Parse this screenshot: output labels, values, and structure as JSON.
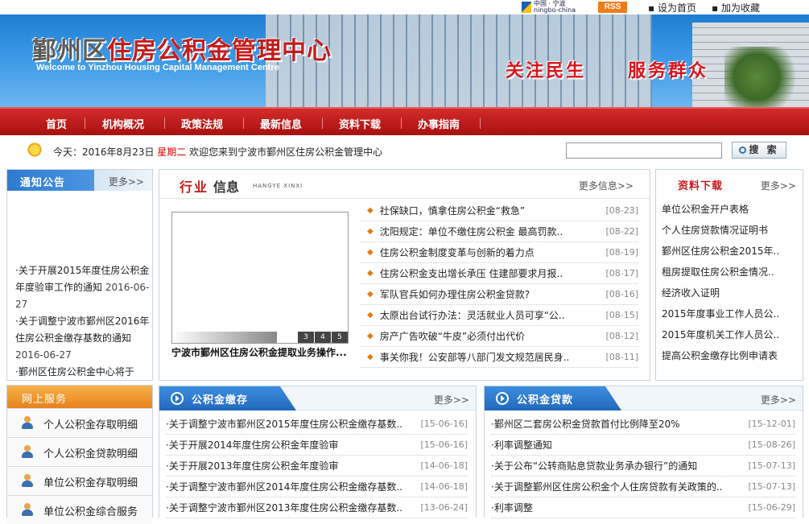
{
  "topbar": {
    "logo_line1": "中国 · 宁波",
    "logo_line2": "ningbo-china",
    "rss": "RSS",
    "set_home": "设为首页",
    "add_fav": "加为收藏"
  },
  "banner": {
    "title_part1": "鄞州区",
    "title_part2": "住房公积金管理中心",
    "subtitle": "Welcome to Yinzhou Housing Capital Management Centre",
    "slogan_left": "关注民生",
    "slogan_right": "服务群众"
  },
  "nav": [
    "首页",
    "机构概况",
    "政策法规",
    "最新信息",
    "资料下载",
    "办事指南"
  ],
  "dateline": {
    "prefix": "今天：",
    "date": "2016年8月23日",
    "weekday": "星期二",
    "welcome": "欢迎您来到宁波市鄞州区住房公积金管理中心"
  },
  "search": {
    "button": "搜 索",
    "placeholder": ""
  },
  "notice": {
    "title": "通知公告",
    "more": "更多>>",
    "items": [
      {
        "text": "·关于开展2015年度住房公积金年度验审工作的通知",
        "date": "2016-06-27"
      },
      {
        "text": "·关于调整宁波市鄞州区2016年住房公积金缴存基数的通知",
        "date": "2016-06-27"
      },
      {
        "text": "·鄞州区住房公积金中心将于",
        "date": ""
      }
    ]
  },
  "industry": {
    "title_red": "行业",
    "title_dark": "信息",
    "pinyin": "HANGYE XINXI",
    "more": "更多信息>>",
    "slide_numbers": [
      "3",
      "4",
      "5"
    ],
    "slide_caption": "宁波市鄞州区住房公积金提取业务操作...",
    "items": [
      {
        "text": "社保缺口，慎拿住房公积金“救急”",
        "date": "[08-23]"
      },
      {
        "text": "沈阳规定：单位不缴住房公积金 最高罚款..",
        "date": "[08-22]"
      },
      {
        "text": "住房公积金制度变革与创新的着力点",
        "date": "[08-19]"
      },
      {
        "text": "住房公积金支出增长承压 住建部要求月报..",
        "date": "[08-17]"
      },
      {
        "text": "军队官兵如何办理住房公积金贷款?",
        "date": "[08-16]"
      },
      {
        "text": "太原出台试行办法：灵活就业人员可享“公..",
        "date": "[08-15]"
      },
      {
        "text": "房产广告吹破“牛皮”必须付出代价",
        "date": "[08-12]"
      },
      {
        "text": "事关你我！公安部等八部门发文规范居民身..",
        "date": "[08-11]"
      }
    ]
  },
  "resources": {
    "title": "资料下载",
    "more": "更多>>",
    "items": [
      "单位公积金开户表格",
      "个人住房贷款情况证明书",
      "鄞州区住房公积金2015年..",
      "租房提取住房公积金情况..",
      "经济收入证明",
      "2015年度事业工作人员公..",
      "2015年度机关工作人员公..",
      "提高公积金缴存比例申请表"
    ]
  },
  "online": {
    "title": "网上服务",
    "items": [
      "个人公积金存取明细",
      "个人公积金贷款明细",
      "单位公积金存取明细",
      "单位公积金综合服务"
    ]
  },
  "deposit": {
    "title": "公积金缴存",
    "more": "更多>>",
    "items": [
      {
        "text": "·关于调整宁波市鄞州区2015年度住房公积金缴存基数..",
        "date": "[15-06-16]"
      },
      {
        "text": "·关于开展2014年度住房公积金年度验审",
        "date": "[15-06-16]"
      },
      {
        "text": "·关于开展2013年度住房公积金年度验审",
        "date": "[14-06-18]"
      },
      {
        "text": "·关于调整宁波市鄞州区2014年度住房公积金缴存基数..",
        "date": "[14-06-18]"
      },
      {
        "text": "·关于调整宁波市鄞州区2013年度住房公积金缴存基数..",
        "date": "[13-06-24]"
      }
    ]
  },
  "loan": {
    "title": "公积金贷款",
    "more": "更多>>",
    "items": [
      {
        "text": "·鄞州区二套房公积金贷款首付比例降至20%",
        "date": "[15-12-01]"
      },
      {
        "text": "·利率调整通知",
        "date": "[15-08-26]"
      },
      {
        "text": "·关于公布“公转商贴息贷款业务承办银行”的通知",
        "date": "[15-07-13]"
      },
      {
        "text": "·关于调整鄞州区住房公积金个人住房贷款有关政策的..",
        "date": "[15-07-13]"
      },
      {
        "text": "·利率调整",
        "date": "[15-06-29]"
      }
    ]
  }
}
